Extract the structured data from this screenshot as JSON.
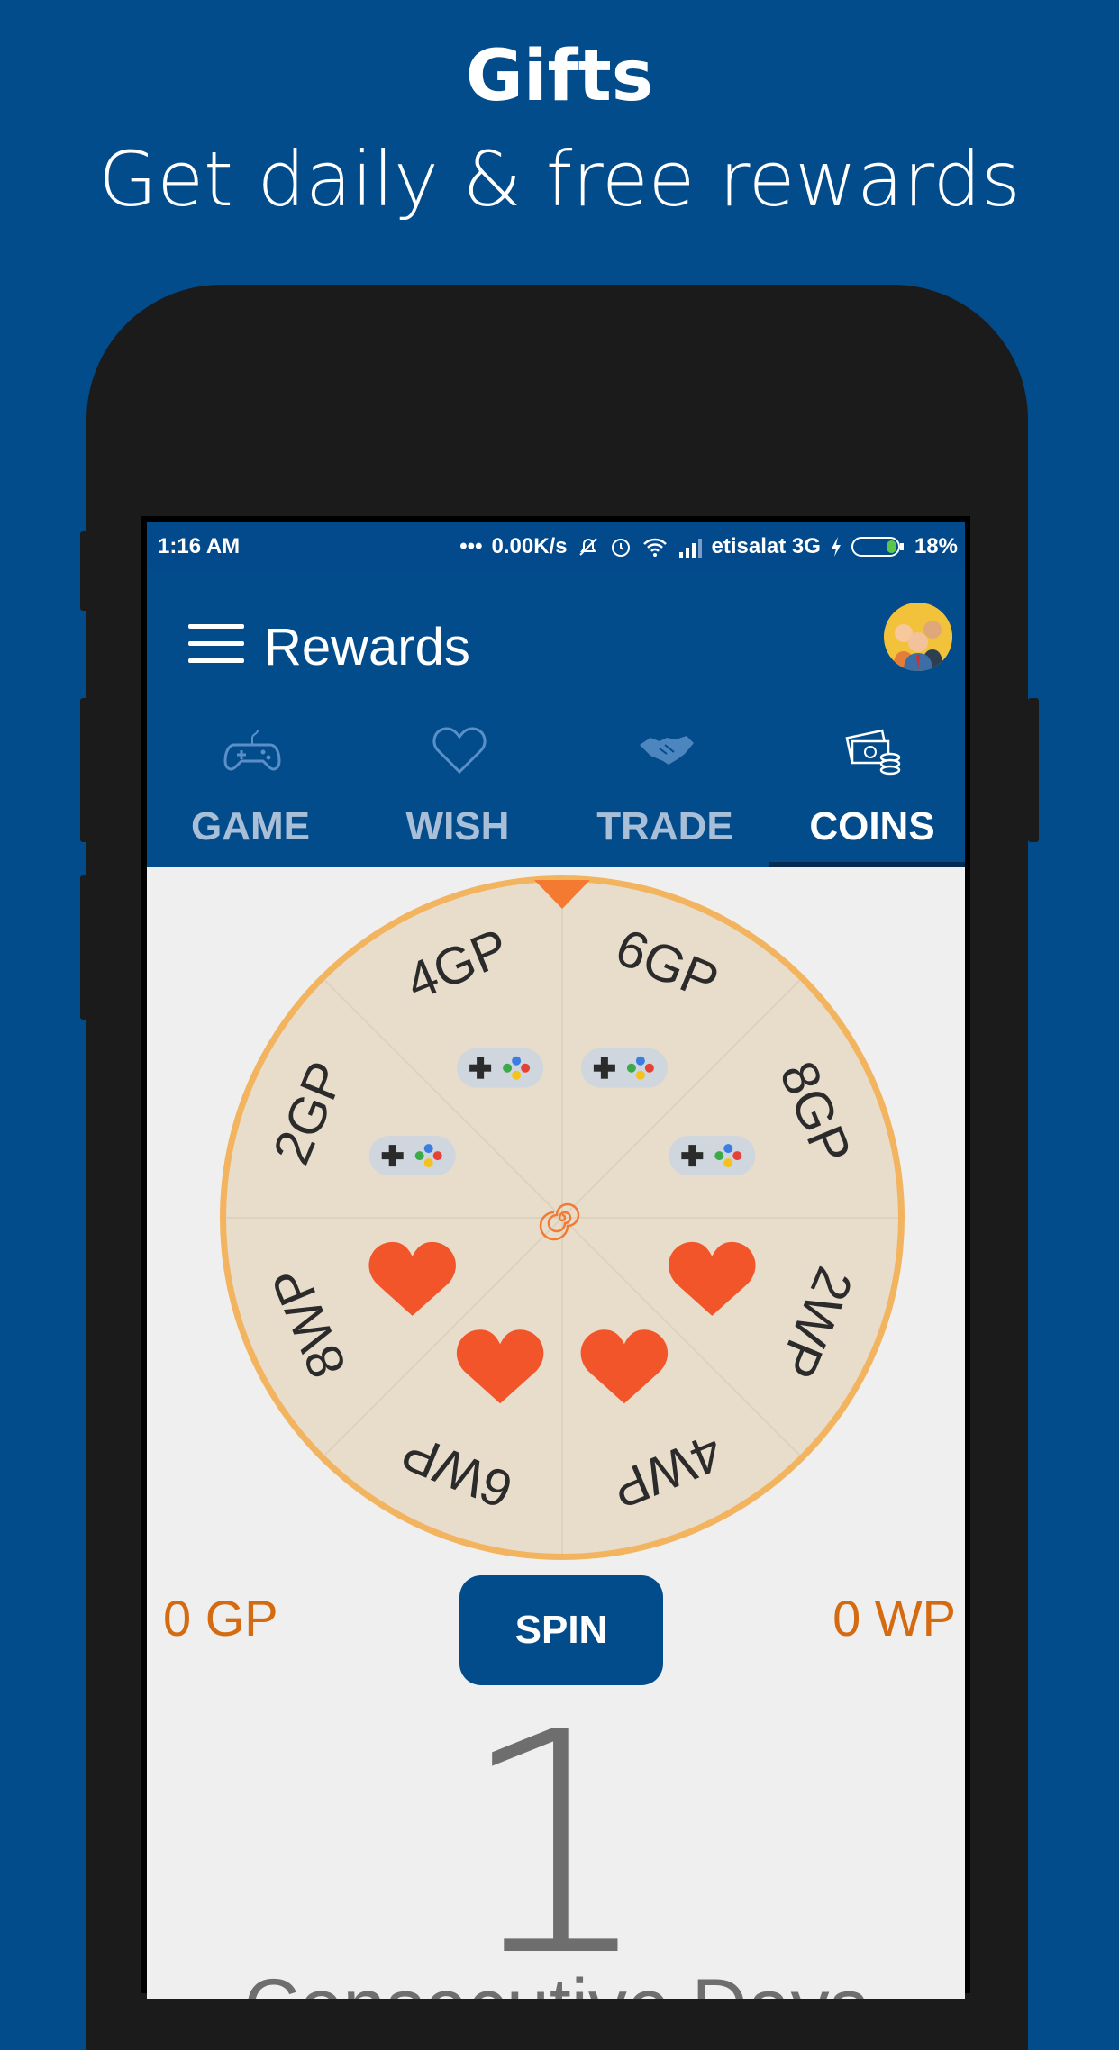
{
  "promo": {
    "title": "Gifts",
    "subtitle": "Get daily & free rewards"
  },
  "statusbar": {
    "time": "1:16 AM",
    "speed": "0.00K/s",
    "carrier": "etisalat 3G",
    "battery": "18%"
  },
  "appbar": {
    "title": "Rewards"
  },
  "tabs": [
    {
      "label": "GAME",
      "icon": "gamepad-icon",
      "active": false
    },
    {
      "label": "WISH",
      "icon": "heart-outline-icon",
      "active": false
    },
    {
      "label": "TRADE",
      "icon": "handshake-icon",
      "active": false
    },
    {
      "label": "COINS",
      "icon": "coins-icon",
      "active": true
    }
  ],
  "wheel": {
    "segments": [
      {
        "label": "6GP",
        "icon": "gamepad-icon"
      },
      {
        "label": "8GP",
        "icon": "gamepad-icon"
      },
      {
        "label": "2WP",
        "icon": "heart-icon"
      },
      {
        "label": "4WP",
        "icon": "heart-icon"
      },
      {
        "label": "6WP",
        "icon": "heart-icon"
      },
      {
        "label": "8WP",
        "icon": "heart-icon"
      },
      {
        "label": "2GP",
        "icon": "gamepad-icon"
      },
      {
        "label": "4GP",
        "icon": "gamepad-icon"
      }
    ],
    "colors": {
      "rim": "#f3b460",
      "face": "#e8dccb",
      "pointer": "#f47a32",
      "heart": "#f2552a"
    }
  },
  "scores": {
    "gp": "0 GP",
    "wp": "0 WP"
  },
  "spin": {
    "label": "SPIN"
  },
  "streak": {
    "count": "1",
    "label": "Consecutive Days"
  },
  "colors": {
    "brand": "#034c8c",
    "accent": "#d46b11"
  }
}
